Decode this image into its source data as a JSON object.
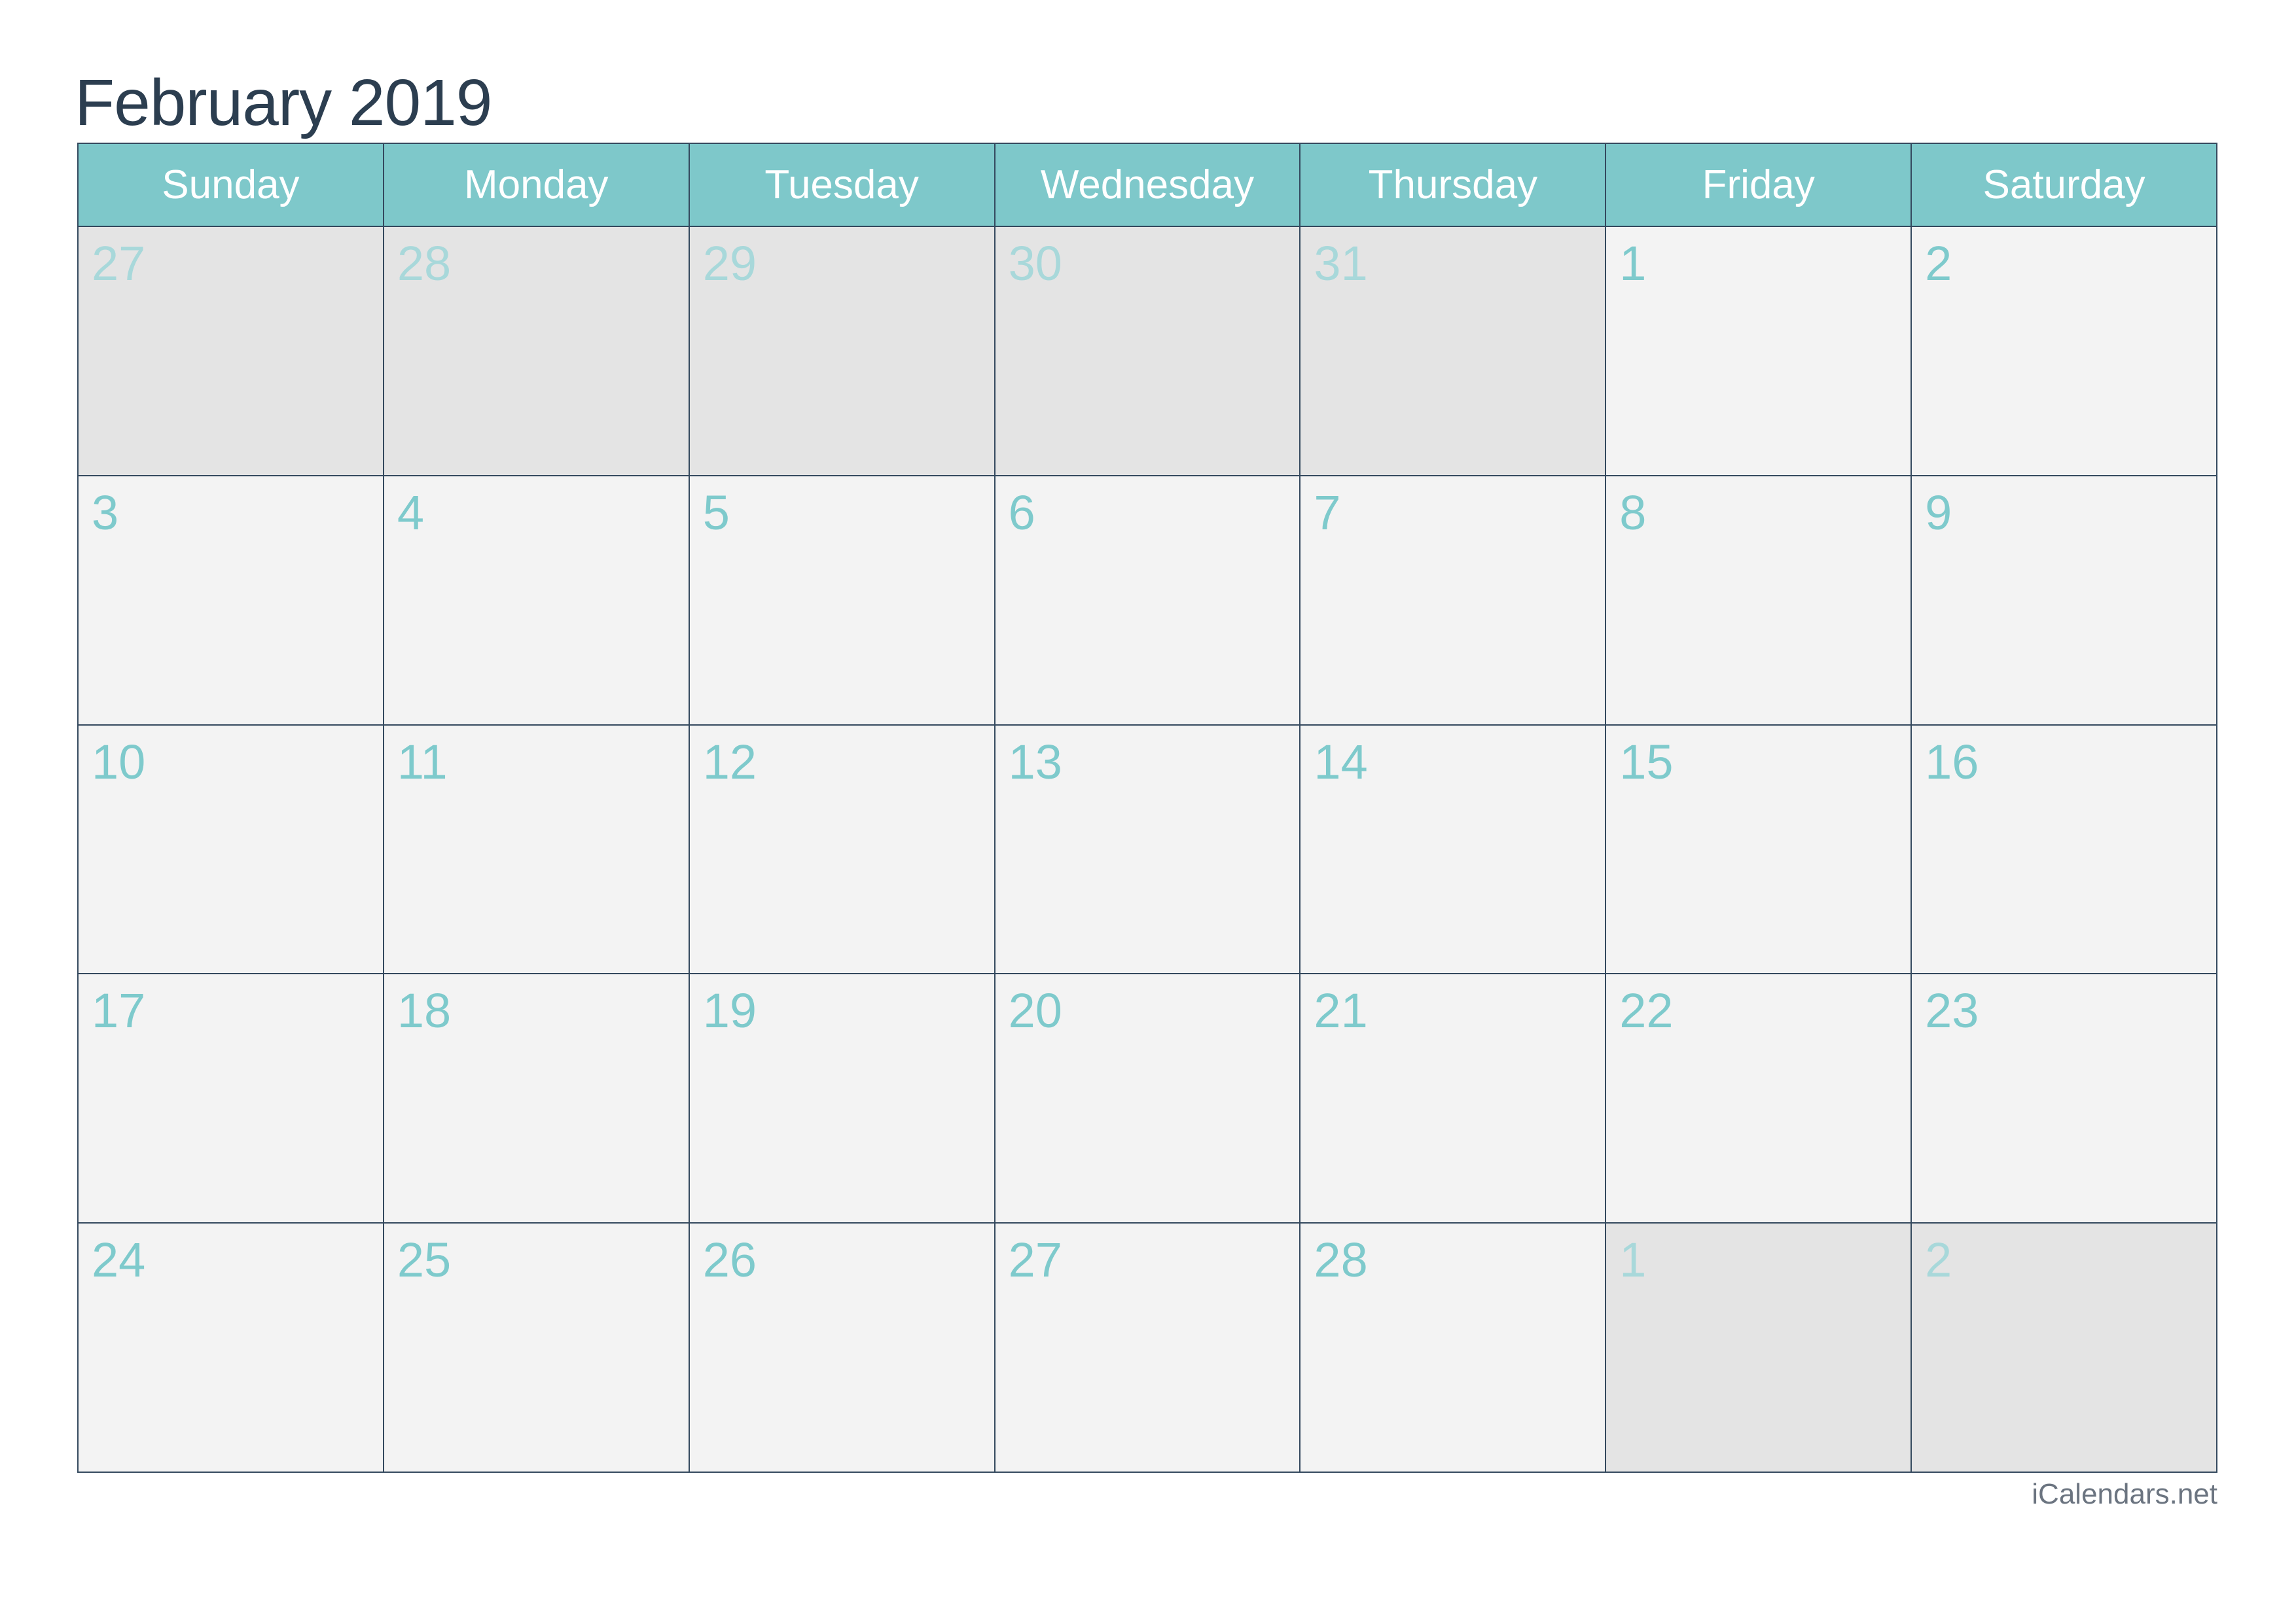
{
  "title": "February 2019",
  "weekdays": [
    "Sunday",
    "Monday",
    "Tuesday",
    "Wednesday",
    "Thursday",
    "Friday",
    "Saturday"
  ],
  "weeks": [
    [
      {
        "day": "27",
        "in_month": false
      },
      {
        "day": "28",
        "in_month": false
      },
      {
        "day": "29",
        "in_month": false
      },
      {
        "day": "30",
        "in_month": false
      },
      {
        "day": "31",
        "in_month": false
      },
      {
        "day": "1",
        "in_month": true
      },
      {
        "day": "2",
        "in_month": true
      }
    ],
    [
      {
        "day": "3",
        "in_month": true
      },
      {
        "day": "4",
        "in_month": true
      },
      {
        "day": "5",
        "in_month": true
      },
      {
        "day": "6",
        "in_month": true
      },
      {
        "day": "7",
        "in_month": true
      },
      {
        "day": "8",
        "in_month": true
      },
      {
        "day": "9",
        "in_month": true
      }
    ],
    [
      {
        "day": "10",
        "in_month": true
      },
      {
        "day": "11",
        "in_month": true
      },
      {
        "day": "12",
        "in_month": true
      },
      {
        "day": "13",
        "in_month": true
      },
      {
        "day": "14",
        "in_month": true
      },
      {
        "day": "15",
        "in_month": true
      },
      {
        "day": "16",
        "in_month": true
      }
    ],
    [
      {
        "day": "17",
        "in_month": true
      },
      {
        "day": "18",
        "in_month": true
      },
      {
        "day": "19",
        "in_month": true
      },
      {
        "day": "20",
        "in_month": true
      },
      {
        "day": "21",
        "in_month": true
      },
      {
        "day": "22",
        "in_month": true
      },
      {
        "day": "23",
        "in_month": true
      }
    ],
    [
      {
        "day": "24",
        "in_month": true
      },
      {
        "day": "25",
        "in_month": true
      },
      {
        "day": "26",
        "in_month": true
      },
      {
        "day": "27",
        "in_month": true
      },
      {
        "day": "28",
        "in_month": true
      },
      {
        "day": "1",
        "in_month": false
      },
      {
        "day": "2",
        "in_month": false
      }
    ]
  ],
  "footer": "iCalendars.net",
  "colors": {
    "title": "#2c3e50",
    "header_bg": "#7ec8ca",
    "day_number": "#7ecacc",
    "day_number_muted": "#a8d8da",
    "cell_bg": "#f3f3f3",
    "cell_bg_other_month": "#e4e4e4",
    "grid_lines": "#34495e"
  }
}
